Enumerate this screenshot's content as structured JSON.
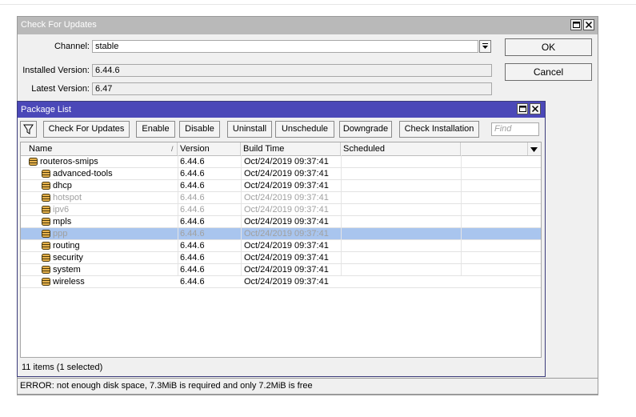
{
  "dialog": {
    "title": "Check For Updates",
    "channel_label": "Channel:",
    "channel_value": "stable",
    "installed_label": "Installed Version:",
    "installed_value": "6.44.6",
    "latest_label": "Latest Version:",
    "latest_value": "6.47",
    "ok_label": "OK",
    "cancel_label": "Cancel",
    "error_text": "ERROR: not enough disk space, 7.3MiB is required and only 7.2MiB is free"
  },
  "package_list": {
    "title": "Package List",
    "toolbar": {
      "check_for_updates": "Check For Updates",
      "enable": "Enable",
      "disable": "Disable",
      "uninstall": "Uninstall",
      "unschedule": "Unschedule",
      "downgrade": "Downgrade",
      "check_installation": "Check Installation",
      "find_placeholder": "Find"
    },
    "columns": {
      "name": "Name",
      "version": "Version",
      "build_time": "Build Time",
      "scheduled": "Scheduled"
    },
    "rows": [
      {
        "name": "routeros-smips",
        "version": "6.44.6",
        "build_time": "Oct/24/2019 09:37:41",
        "scheduled": ""
      },
      {
        "name": "advanced-tools",
        "version": "6.44.6",
        "build_time": "Oct/24/2019 09:37:41",
        "scheduled": ""
      },
      {
        "name": "dhcp",
        "version": "6.44.6",
        "build_time": "Oct/24/2019 09:37:41",
        "scheduled": ""
      },
      {
        "name": "hotspot",
        "version": "6.44.6",
        "build_time": "Oct/24/2019 09:37:41",
        "scheduled": ""
      },
      {
        "name": "ipv6",
        "version": "6.44.6",
        "build_time": "Oct/24/2019 09:37:41",
        "scheduled": ""
      },
      {
        "name": "mpls",
        "version": "6.44.6",
        "build_time": "Oct/24/2019 09:37:41",
        "scheduled": ""
      },
      {
        "name": "ppp",
        "version": "6.44.6",
        "build_time": "Oct/24/2019 09:37:41",
        "scheduled": ""
      },
      {
        "name": "routing",
        "version": "6.44.6",
        "build_time": "Oct/24/2019 09:37:41",
        "scheduled": ""
      },
      {
        "name": "security",
        "version": "6.44.6",
        "build_time": "Oct/24/2019 09:37:41",
        "scheduled": ""
      },
      {
        "name": "system",
        "version": "6.44.6",
        "build_time": "Oct/24/2019 09:37:41",
        "scheduled": ""
      },
      {
        "name": "wireless",
        "version": "6.44.6",
        "build_time": "Oct/24/2019 09:37:41",
        "scheduled": ""
      }
    ],
    "status_text": "11 items (1 selected)"
  },
  "colors": {
    "active_titlebar": "#4b48b8",
    "inactive_titlebar": "#b9b9b9",
    "selected_row": "#a9c5ee",
    "disabled_text": "#a0a0a0"
  },
  "icons": {
    "filter": "filter-icon",
    "package": "package-icon",
    "maximize": "maximize-icon",
    "close": "close-icon",
    "dropdown": "dropdown-arrow-icon"
  }
}
